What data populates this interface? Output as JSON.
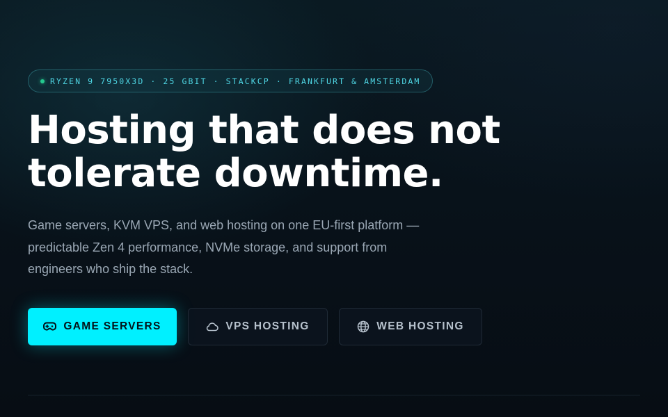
{
  "hero": {
    "badge": "RYZEN 9 7950X3D · 25 GBIT · STACKCP · FRANKFURT & AMSTERDAM",
    "headline": "Hosting that does not tolerate downtime.",
    "subtext": "Game servers, KVM VPS, and web hosting on one EU-first platform — predictable Zen 4 performance, NVMe storage, and support from engineers who ship the stack."
  },
  "actions": {
    "game_servers": {
      "label": "GAME SERVERS",
      "icon": "gamepad-icon"
    },
    "vps_hosting": {
      "label": "VPS HOSTING",
      "icon": "cloud-icon"
    },
    "web_hosting": {
      "label": "WEB HOSTING",
      "icon": "globe-icon"
    }
  },
  "colors": {
    "accent": "#00f0ff",
    "badge_text": "#4fd6e4",
    "status_dot": "#25c98f",
    "background": "#08121a",
    "muted_text": "#9aa7b4"
  }
}
